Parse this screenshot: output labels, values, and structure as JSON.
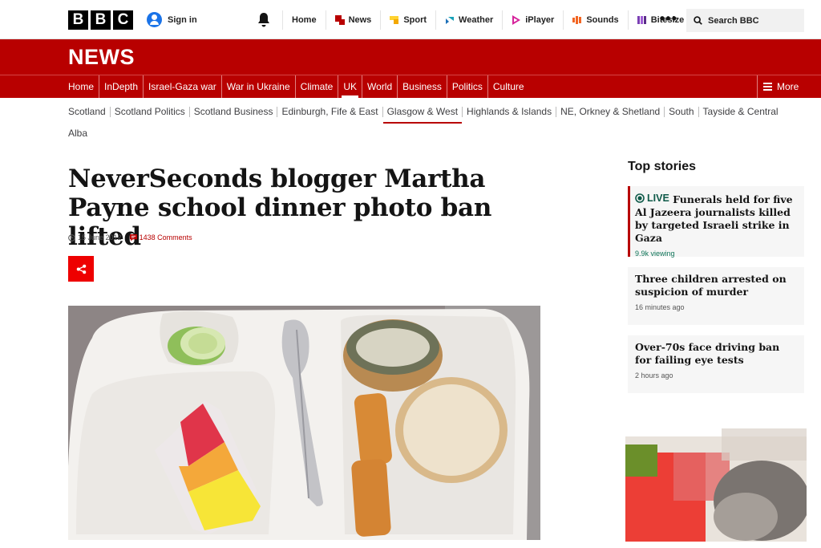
{
  "masthead": {
    "logo_letters": [
      "B",
      "B",
      "C"
    ],
    "sign_in": "Sign in",
    "nav": [
      {
        "label": "Home",
        "icon": "none"
      },
      {
        "label": "News",
        "icon": "news-icon",
        "color": "#b80000"
      },
      {
        "label": "Sport",
        "icon": "sport-icon",
        "color": "#ffd230"
      },
      {
        "label": "Weather",
        "icon": "weather-icon",
        "color": "#1d70b8"
      },
      {
        "label": "iPlayer",
        "icon": "iplayer-icon",
        "color": "#d6239b"
      },
      {
        "label": "Sounds",
        "icon": "sounds-icon",
        "color": "#f26522"
      },
      {
        "label": "Bitesize",
        "icon": "bitesize-icon",
        "color": "#7b3fb5"
      }
    ],
    "search_placeholder": "Search BBC"
  },
  "news_banner": {
    "title": "NEWS"
  },
  "sections": [
    "Home",
    "InDepth",
    "Israel-Gaza war",
    "War in Ukraine",
    "Climate",
    "UK",
    "World",
    "Business",
    "Politics",
    "Culture"
  ],
  "active_section": "UK",
  "more_label": "More",
  "subsections": [
    "Scotland",
    "Scotland Politics",
    "Scotland Business",
    "Edinburgh, Fife & East",
    "Glasgow & West",
    "Highlands & Islands",
    "NE, Orkney & Shetland",
    "South",
    "Tayside & Central",
    "Alba"
  ],
  "active_subsection": "Glasgow & West",
  "article": {
    "headline": "NeverSeconds blogger Martha Payne school dinner photo ban lifted",
    "date": "15 June 2012",
    "comments": "1438 Comments"
  },
  "top_stories": {
    "title": "Top stories",
    "items": [
      {
        "live_label": "LIVE",
        "headline": "Funerals held for five Al Jazeera journalists killed by targeted Israeli strike in Gaza",
        "sub": "9.9k viewing"
      },
      {
        "headline": "Three children arrested on suspicion of murder",
        "sub": "16 minutes ago"
      },
      {
        "headline": "Over-70s face driving ban for failing eye tests",
        "sub": "2 hours ago"
      }
    ]
  },
  "colors": {
    "brand_red": "#b80000",
    "live_green": "#0f5a49"
  }
}
